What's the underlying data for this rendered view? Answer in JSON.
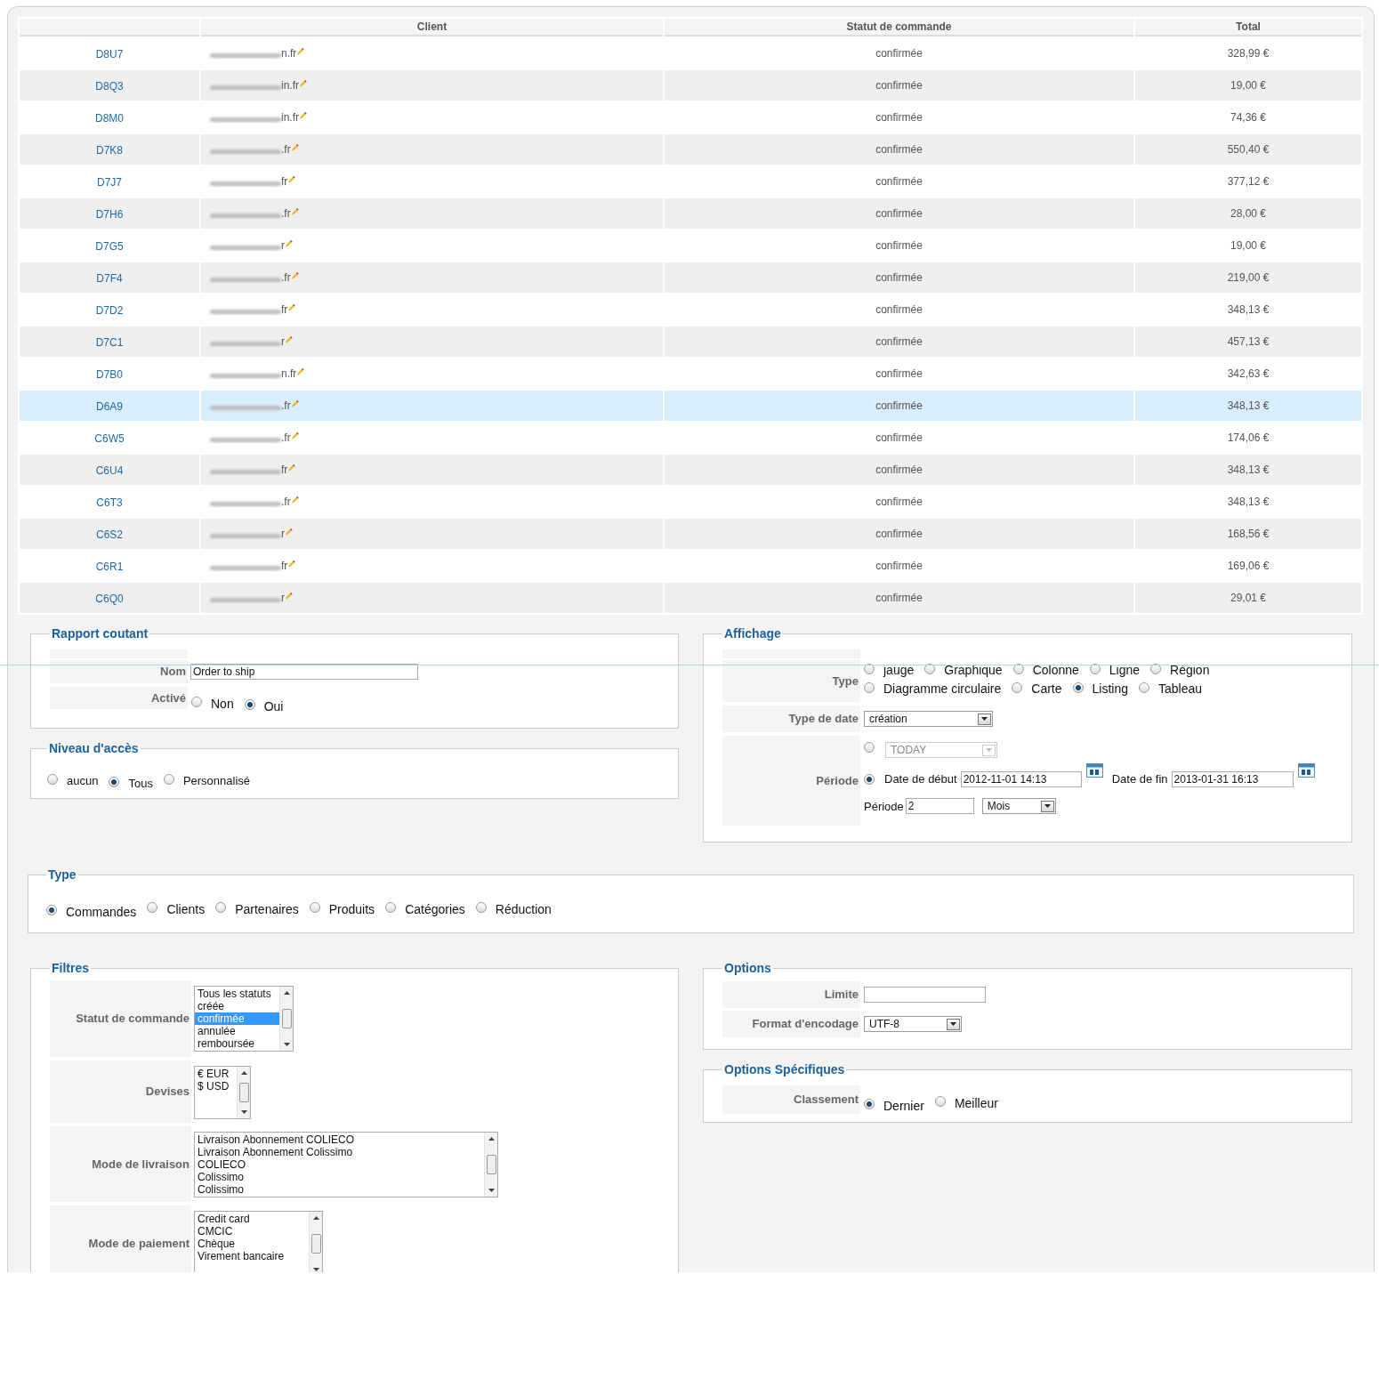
{
  "table": {
    "columns": [
      "Client",
      "Statut de commande",
      "Total"
    ],
    "rows": [
      {
        "ref": "D8U7",
        "client": "n.fr",
        "status": "confirmée",
        "total": "328,99 €",
        "highlighted": false
      },
      {
        "ref": "D8Q3",
        "client": "in.fr",
        "status": "confirmée",
        "total": "19,00 €",
        "highlighted": false
      },
      {
        "ref": "D8M0",
        "client": "in.fr",
        "status": "confirmée",
        "total": "74,36 €",
        "highlighted": false
      },
      {
        "ref": "D7K8",
        "client": ".fr",
        "status": "confirmée",
        "total": "550,40 €",
        "highlighted": false
      },
      {
        "ref": "D7J7",
        "client": "fr",
        "status": "confirmée",
        "total": "377,12 €",
        "highlighted": false
      },
      {
        "ref": "D7H6",
        "client": ".fr",
        "status": "confirmée",
        "total": "28,00 €",
        "highlighted": false
      },
      {
        "ref": "D7G5",
        "client": "r",
        "status": "confirmée",
        "total": "19,00 €",
        "highlighted": false
      },
      {
        "ref": "D7F4",
        "client": ".fr",
        "status": "confirmée",
        "total": "219,00 €",
        "highlighted": false
      },
      {
        "ref": "D7D2",
        "client": "fr",
        "status": "confirmée",
        "total": "348,13 €",
        "highlighted": false
      },
      {
        "ref": "D7C1",
        "client": "r",
        "status": "confirmée",
        "total": "457,13 €",
        "highlighted": false
      },
      {
        "ref": "D7B0",
        "client": "n.fr",
        "status": "confirmée",
        "total": "342,63 €",
        "highlighted": false
      },
      {
        "ref": "D6A9",
        "client": ".fr",
        "status": "confirmée",
        "total": "348,13 €",
        "highlighted": true
      },
      {
        "ref": "C6W5",
        "client": ".fr",
        "status": "confirmée",
        "total": "174,06 €",
        "highlighted": false
      },
      {
        "ref": "C6U4",
        "client": "fr",
        "status": "confirmée",
        "total": "348,13 €",
        "highlighted": false
      },
      {
        "ref": "C6T3",
        "client": ".fr",
        "status": "confirmée",
        "total": "348,13 €",
        "highlighted": false
      },
      {
        "ref": "C6S2",
        "client": "r",
        "status": "confirmée",
        "total": "168,56 €",
        "highlighted": false
      },
      {
        "ref": "C6R1",
        "client": "fr",
        "status": "confirmée",
        "total": "169,06 €",
        "highlighted": false
      },
      {
        "ref": "C6Q0",
        "client": "r",
        "status": "confirmée",
        "total": "29,01 €",
        "highlighted": false
      }
    ]
  },
  "rapport": {
    "legend": "Rapport coutant",
    "name": {
      "label": "Nom",
      "value": "Order to ship"
    },
    "active": {
      "label": "Activé",
      "options": [
        {
          "label": "Non",
          "selected": false
        },
        {
          "label": "Oui",
          "selected": true
        }
      ]
    }
  },
  "access": {
    "legend": "Niveau d'accès",
    "options": [
      {
        "label": "aucun",
        "selected": false
      },
      {
        "label": "Tous",
        "selected": true
      },
      {
        "label": "Personnalisé",
        "selected": false
      }
    ]
  },
  "display": {
    "legend": "Affichage",
    "type": {
      "label": "Type",
      "options": [
        {
          "label": "jauge",
          "selected": false
        },
        {
          "label": "Graphique",
          "selected": false
        },
        {
          "label": "Colonne",
          "selected": false
        },
        {
          "label": "Ligne",
          "selected": false
        },
        {
          "label": "Région",
          "selected": false
        },
        {
          "label": "Diagramme circulaire",
          "selected": false
        },
        {
          "label": "Carte",
          "selected": false
        },
        {
          "label": "Listing",
          "selected": true
        },
        {
          "label": "Tableau",
          "selected": false
        }
      ]
    },
    "date_type": {
      "label": "Type de date",
      "value": "création"
    },
    "period": {
      "label": "Période",
      "preset": {
        "selected": false,
        "value": "TODAY",
        "disabled": true
      },
      "range": {
        "selected": true,
        "start_label": "Date de début",
        "start": "2012-11-01 14:13",
        "end_label": "Date de fin",
        "end": "2013-01-31 16:13"
      },
      "count_label": "Période",
      "count": "2",
      "unit": "Mois"
    }
  },
  "type_section": {
    "legend": "Type",
    "options": [
      {
        "label": "Commandes",
        "selected": true
      },
      {
        "label": "Clients",
        "selected": false
      },
      {
        "label": "Partenaires",
        "selected": false
      },
      {
        "label": "Produits",
        "selected": false
      },
      {
        "label": "Catégories",
        "selected": false
      },
      {
        "label": "Réduction",
        "selected": false
      }
    ]
  },
  "filters": {
    "legend": "Filtres",
    "fields": [
      {
        "label": "Statut de commande",
        "items": [
          {
            "label": "Tous les statuts",
            "selected": false
          },
          {
            "label": "créée",
            "selected": false
          },
          {
            "label": "confirmée",
            "selected": true
          },
          {
            "label": "annulée",
            "selected": false
          },
          {
            "label": "remboursée",
            "selected": false
          }
        ]
      },
      {
        "label": "Devises",
        "items": [
          {
            "label": "€ EUR",
            "selected": false
          },
          {
            "label": "$ USD",
            "selected": false
          }
        ]
      },
      {
        "label": "Mode de livraison",
        "items": [
          {
            "label": "Livraison Abonnement COLIECO",
            "selected": false
          },
          {
            "label": "Livraison Abonnement Colissimo",
            "selected": false
          },
          {
            "label": "COLIECO",
            "selected": false
          },
          {
            "label": "Colissimo",
            "selected": false
          },
          {
            "label": "Colissimo",
            "selected": false
          }
        ]
      },
      {
        "label": "Mode de paiement",
        "items": [
          {
            "label": "Credit card",
            "selected": false
          },
          {
            "label": "CMCIC",
            "selected": false
          },
          {
            "label": "Chèque",
            "selected": false
          },
          {
            "label": "Virement bancaire",
            "selected": false
          }
        ]
      }
    ]
  },
  "options": {
    "legend": "Options",
    "limit": {
      "label": "Limite"
    },
    "encoding": {
      "label": "Format d'encodage",
      "value": "UTF-8"
    }
  },
  "specific": {
    "legend": "Options Spécifiques",
    "ranking": {
      "label": "Classement",
      "options": [
        {
          "label": "Dernier",
          "selected": true
        },
        {
          "label": "Meilleur",
          "selected": false
        }
      ]
    }
  }
}
